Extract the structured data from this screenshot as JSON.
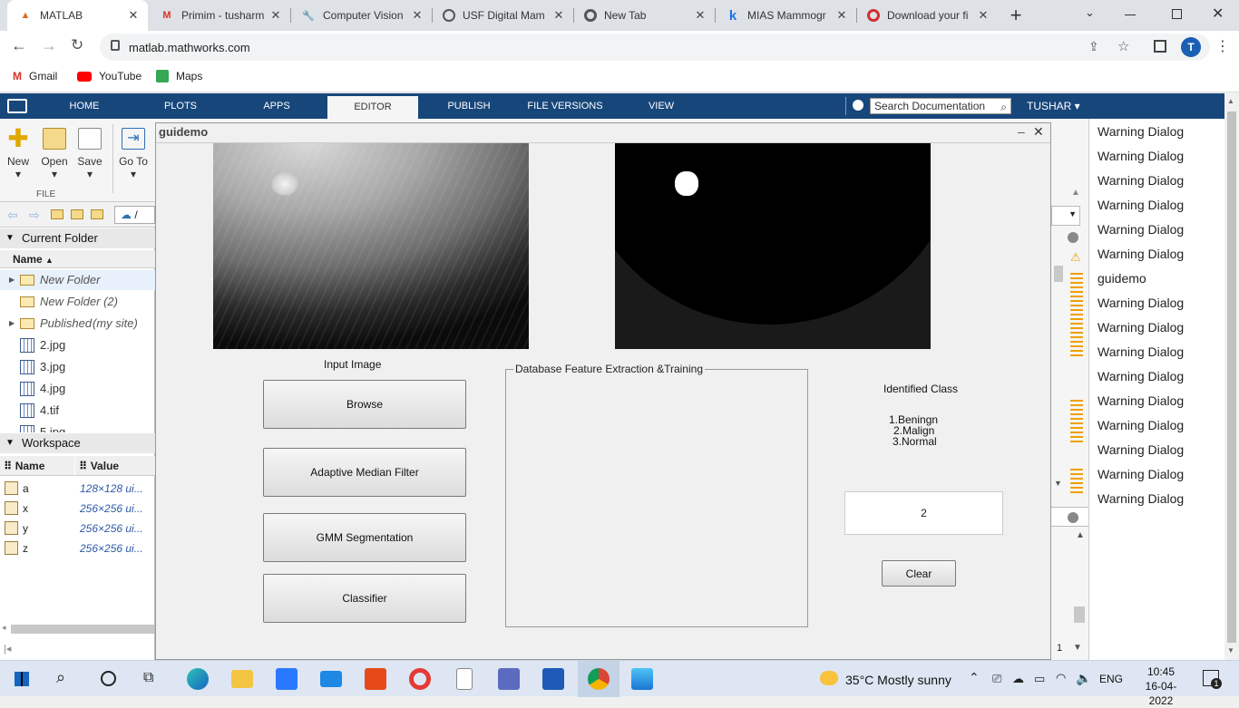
{
  "browser": {
    "tabs": [
      {
        "label": "MATLAB",
        "icon": "matlab-icon",
        "active": true
      },
      {
        "label": "Primim - tusharm",
        "icon": "gmail-icon"
      },
      {
        "label": "Computer Vision",
        "icon": "wrench-icon"
      },
      {
        "label": "USF Digital Mam",
        "icon": "globe-icon"
      },
      {
        "label": "New Tab",
        "icon": "chrome-icon"
      },
      {
        "label": "MIAS Mammogr",
        "icon": "k-icon"
      },
      {
        "label": "Download your fi",
        "icon": "download-icon"
      }
    ],
    "new_tab": "+",
    "url": "matlab.mathworks.com",
    "profile_initial": "T",
    "bookmarks": [
      {
        "label": "Gmail",
        "icon": "gmail-icon"
      },
      {
        "label": "YouTube",
        "icon": "youtube-icon"
      },
      {
        "label": "Maps",
        "icon": "maps-icon"
      }
    ]
  },
  "matlab": {
    "tabs": [
      "HOME",
      "PLOTS",
      "APPS",
      "EDITOR",
      "PUBLISH",
      "FILE VERSIONS",
      "VIEW"
    ],
    "selected_tab": "EDITOR",
    "search_placeholder": "Search Documentation",
    "user": "TUSHAR",
    "toolstrip": {
      "buttons": [
        "New",
        "Open",
        "Save",
        "Go To"
      ],
      "section": "FILE"
    },
    "path_prefix": "/",
    "current_folder": {
      "title": "Current Folder",
      "column": "Name",
      "items": [
        {
          "name": "New Folder",
          "type": "folder",
          "expandable": true
        },
        {
          "name": "New Folder (2)",
          "type": "folder",
          "expandable": false
        },
        {
          "name": "Published",
          "suffix": "(my site)",
          "type": "folder",
          "expandable": true
        },
        {
          "name": "2.jpg",
          "type": "file"
        },
        {
          "name": "3.jpg",
          "type": "file"
        },
        {
          "name": "4.jpg",
          "type": "file"
        },
        {
          "name": "4.tif",
          "type": "file"
        },
        {
          "name": "5.jpg",
          "type": "file"
        }
      ]
    },
    "workspace": {
      "title": "Workspace",
      "columns": [
        "Name",
        "Value"
      ],
      "rows": [
        {
          "name": "a",
          "value": "128×128 ui..."
        },
        {
          "name": "x",
          "value": "256×256 ui..."
        },
        {
          "name": "y",
          "value": "256×256 ui..."
        },
        {
          "name": "z",
          "value": "256×256 ui..."
        }
      ]
    },
    "right_panel_items": [
      "Warning Dialog",
      "Warning Dialog",
      "Warning Dialog",
      "Warning Dialog",
      "Warning Dialog",
      "Warning Dialog",
      "guidemo",
      "Warning Dialog",
      "Warning Dialog",
      "Warning Dialog",
      "Warning Dialog",
      "Warning Dialog",
      "Warning Dialog",
      "Warning Dialog",
      "Warning Dialog",
      "Warning Dialog"
    ],
    "line_number": "1"
  },
  "gui": {
    "title": "guidemo",
    "input_label": "Input Image",
    "buttons": [
      "Browse",
      "Adaptive Median Filter",
      "GMM Segmentation",
      "Classifier"
    ],
    "panel_title": "Database Feature Extraction &Training",
    "identified_class": "Identified Class",
    "class_list": [
      "1.Beningn",
      "2.Malign",
      "3.Normal"
    ],
    "result_value": "2",
    "clear_label": "Clear"
  },
  "taskbar": {
    "weather": "35°C  Mostly sunny",
    "language": "ENG",
    "time": "10:45",
    "date": "16-04-2022",
    "notifications": "1"
  },
  "colors": {
    "matlab_blue": "#17467a",
    "chrome_tabstrip": "#dee1e6",
    "taskbar": "#dde6f2"
  }
}
